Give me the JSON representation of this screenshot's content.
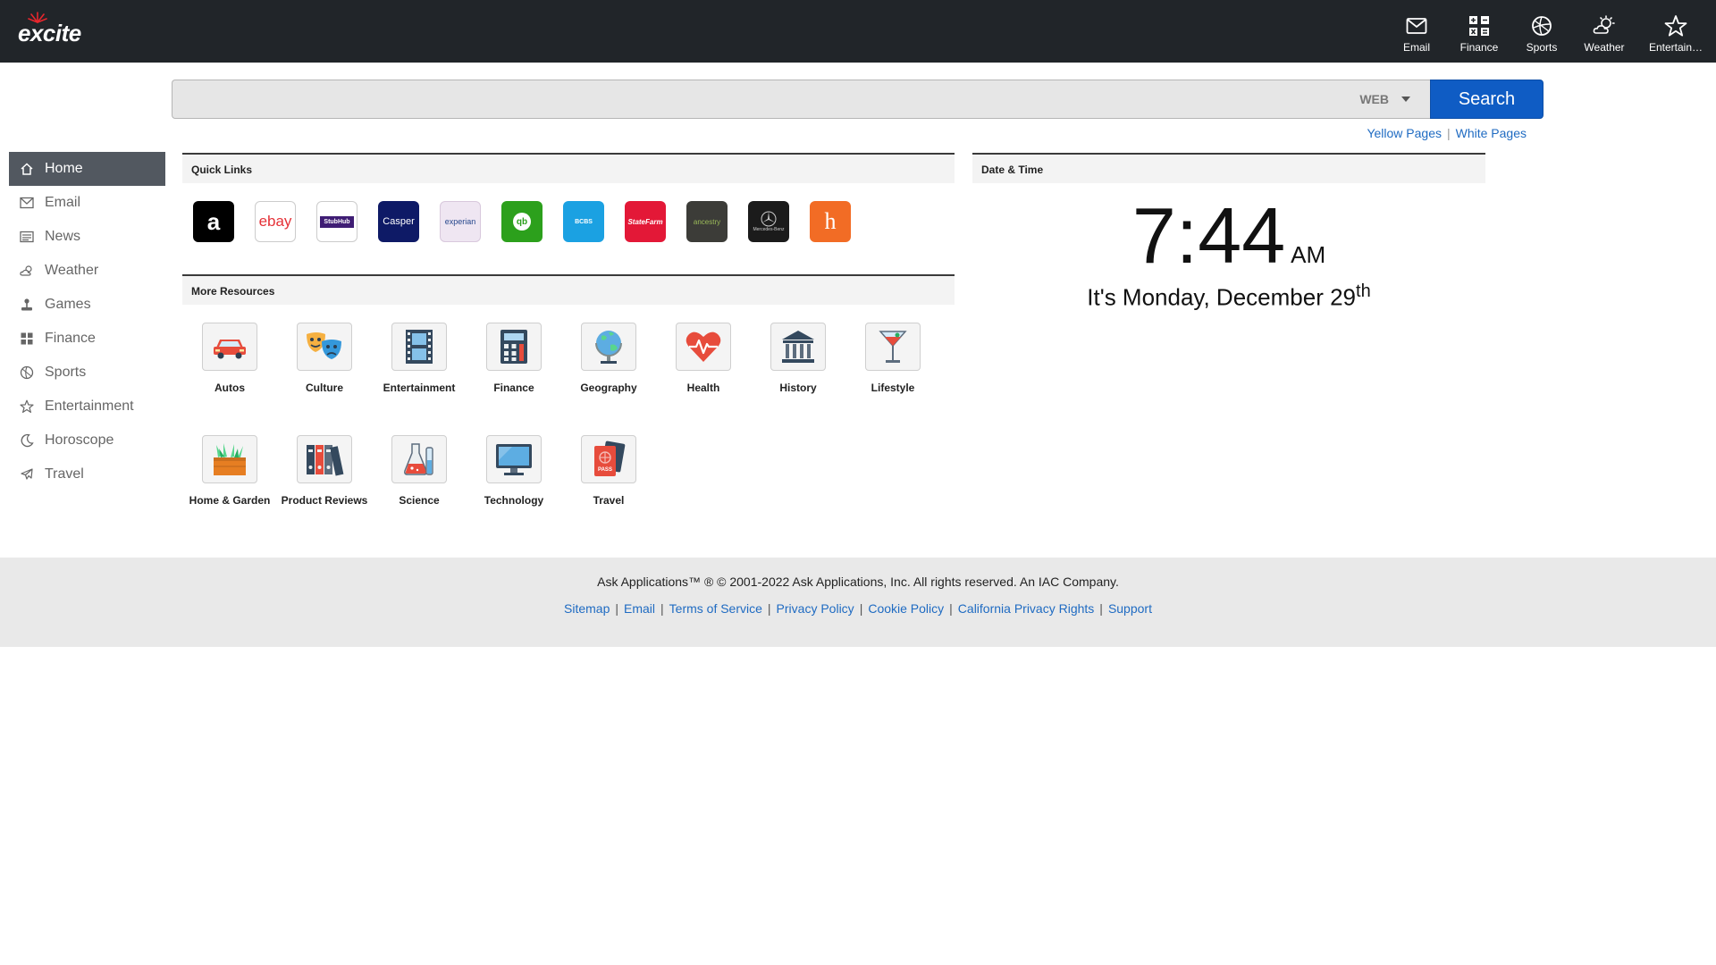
{
  "brand": {
    "logo_text": "excite"
  },
  "topnav": [
    {
      "label": "Email",
      "icon": "envelope-icon"
    },
    {
      "label": "Finance",
      "icon": "grid-finance-icon"
    },
    {
      "label": "Sports",
      "icon": "ball-icon"
    },
    {
      "label": "Weather",
      "icon": "sun-cloud-icon"
    },
    {
      "label": "Entertain…",
      "icon": "star-icon"
    }
  ],
  "search": {
    "value": "",
    "placeholder": "",
    "type_label": "WEB",
    "button_label": "Search"
  },
  "sublinks": {
    "yellow": "Yellow Pages",
    "white": "White Pages"
  },
  "sidebar": {
    "items": [
      {
        "label": "Home",
        "icon": "home-icon",
        "active": true
      },
      {
        "label": "Email",
        "icon": "envelope-icon"
      },
      {
        "label": "News",
        "icon": "newspaper-icon"
      },
      {
        "label": "Weather",
        "icon": "sun-cloud-icon"
      },
      {
        "label": "Games",
        "icon": "joystick-icon"
      },
      {
        "label": "Finance",
        "icon": "grid-finance-icon"
      },
      {
        "label": "Sports",
        "icon": "ball-icon"
      },
      {
        "label": "Entertainment",
        "icon": "star-icon"
      },
      {
        "label": "Horoscope",
        "icon": "moon-icon"
      },
      {
        "label": "Travel",
        "icon": "plane-icon"
      }
    ]
  },
  "quick_links": {
    "title": "Quick Links",
    "items": [
      {
        "label": "a",
        "name": "amazon",
        "bg": "#000000",
        "fg": "#ffffff"
      },
      {
        "label": "ebay",
        "name": "ebay",
        "bg": "#ffffff",
        "fg": "#e53238"
      },
      {
        "label": "StubHub",
        "name": "stubhub",
        "bg": "#ffffff",
        "fg": "#3f1d74"
      },
      {
        "label": "Casper",
        "name": "casper",
        "bg": "#0e1a66",
        "fg": "#ffffff"
      },
      {
        "label": "experian",
        "name": "experian",
        "bg": "#efe6f2",
        "fg": "#26478d"
      },
      {
        "label": "qb",
        "name": "quickbooks",
        "bg": "#2ca01c",
        "fg": "#ffffff"
      },
      {
        "label": "BCBS",
        "name": "bluecross",
        "bg": "#1ba1e2",
        "fg": "#ffffff"
      },
      {
        "label": "StateFarm",
        "name": "statefarm",
        "bg": "#e31837",
        "fg": "#ffffff"
      },
      {
        "label": "ancestry",
        "name": "ancestry",
        "bg": "#3c3c38",
        "fg": "#9bbb59"
      },
      {
        "label": "Mercedes-Benz",
        "name": "mercedes",
        "bg": "#1b1b1b",
        "fg": "#cccccc"
      },
      {
        "label": "h",
        "name": "honey",
        "bg": "#f26c25",
        "fg": "#ffffff"
      }
    ]
  },
  "more_resources": {
    "title": "More Resources",
    "items": [
      {
        "label": "Autos",
        "icon": "car-icon"
      },
      {
        "label": "Culture",
        "icon": "theater-masks-icon"
      },
      {
        "label": "Entertainment",
        "icon": "film-strip-icon"
      },
      {
        "label": "Finance",
        "icon": "calculator-icon"
      },
      {
        "label": "Geography",
        "icon": "globe-icon"
      },
      {
        "label": "Health",
        "icon": "heart-pulse-icon"
      },
      {
        "label": "History",
        "icon": "museum-icon"
      },
      {
        "label": "Lifestyle",
        "icon": "cocktail-icon"
      },
      {
        "label": "Home & Garden",
        "icon": "planter-icon"
      },
      {
        "label": "Product Reviews",
        "icon": "binders-icon"
      },
      {
        "label": "Science",
        "icon": "flask-icon"
      },
      {
        "label": "Technology",
        "icon": "monitor-icon"
      },
      {
        "label": "Travel",
        "icon": "passport-icon"
      }
    ]
  },
  "datetime": {
    "title": "Date & Time",
    "time": "7:44",
    "ampm": "AM",
    "date_text": "It's Monday, December 29",
    "date_suffix": "th"
  },
  "footer": {
    "copyright": "Ask Applications™ ® © 2001-2022 Ask Applications, Inc. All rights reserved. An IAC Company.",
    "links": [
      "Sitemap",
      "Email",
      "Terms of Service",
      "Privacy Policy",
      "Cookie Policy",
      "California Privacy Rights",
      "Support"
    ]
  },
  "colors": {
    "topbar": "#212529",
    "accent": "#0f5cc4",
    "link": "#1f6bc2",
    "sidebar_active": "#525860",
    "footer": "#e9e9e9"
  }
}
